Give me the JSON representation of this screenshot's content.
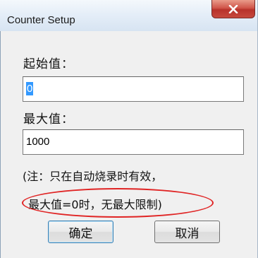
{
  "window": {
    "title": "Counter Setup",
    "close_icon": "close-icon"
  },
  "form": {
    "start_label": "起始值：",
    "start_value": "0",
    "max_label": "最大值：",
    "max_value": "1000"
  },
  "note": {
    "line1": "(注：只在自动烧录时有效，",
    "line2": "最大值=0时，无最大限制)"
  },
  "buttons": {
    "ok_label": "确定",
    "cancel_label": "取消"
  },
  "colors": {
    "annotation_ellipse": "#e02424",
    "selection_highlight": "#3399ff",
    "close_button": "#c6493d"
  }
}
